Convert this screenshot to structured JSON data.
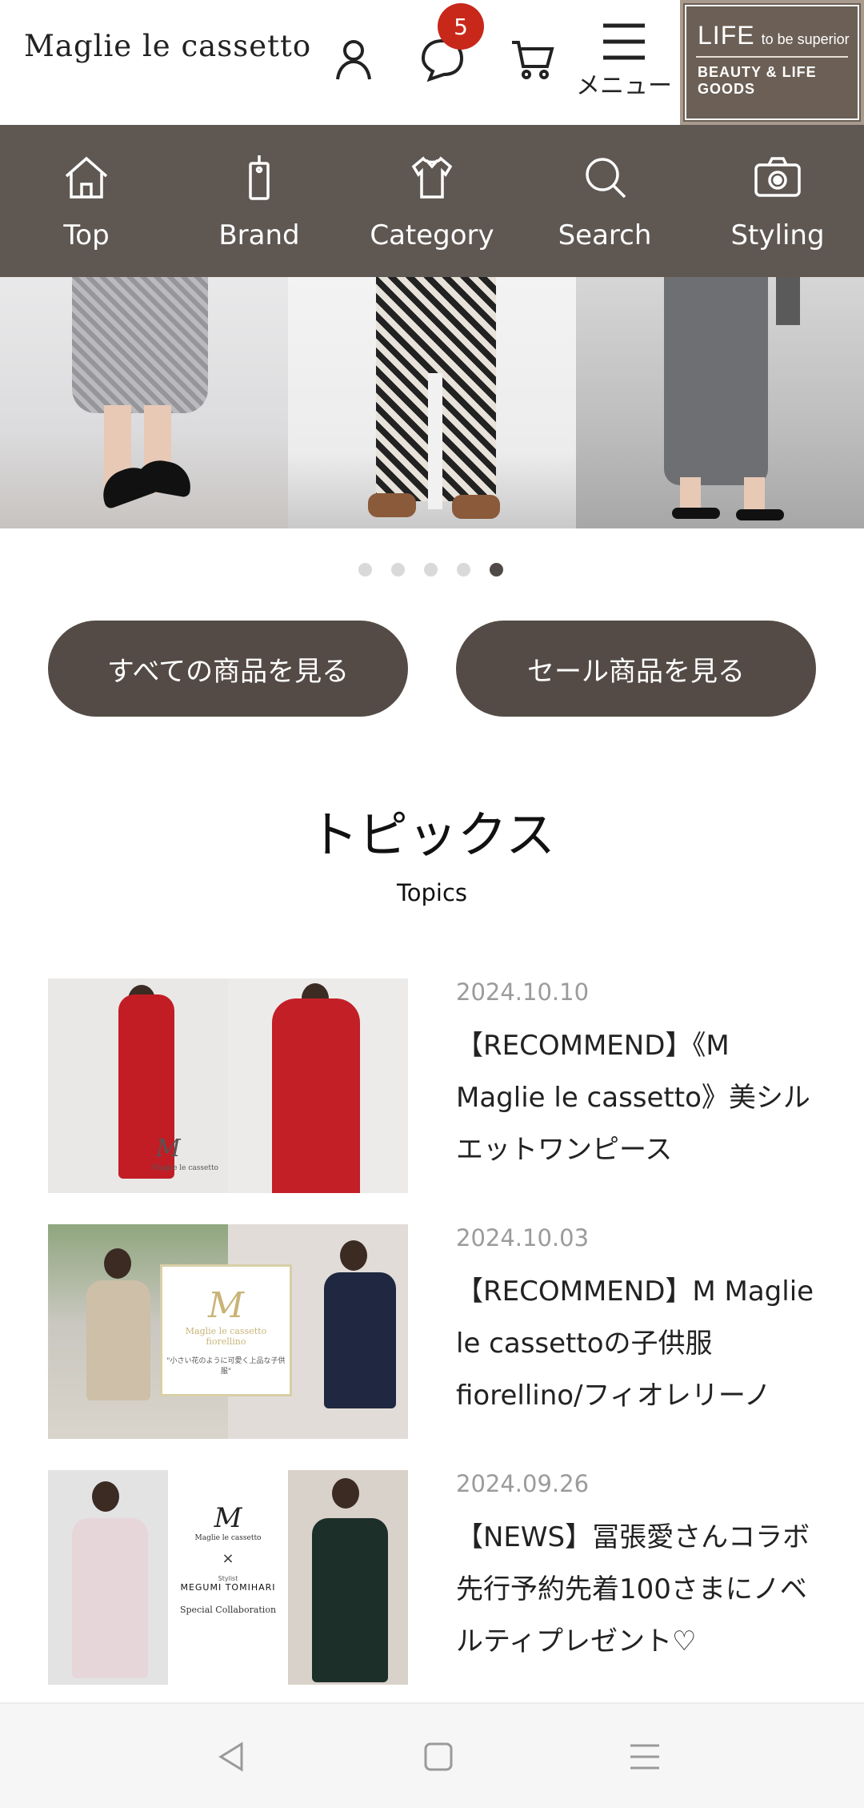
{
  "header": {
    "logo": "Maglie le cassetto",
    "badge_count": "5",
    "menu_label": "メニュー",
    "life_banner": {
      "life": "LIFE",
      "tagline": "to be superior",
      "goods": "BEAUTY & LIFE GOODS"
    }
  },
  "nav": {
    "items": [
      {
        "label": "Top",
        "icon": "home-icon"
      },
      {
        "label": "Brand",
        "icon": "tag-icon"
      },
      {
        "label": "Category",
        "icon": "shirt-icon"
      },
      {
        "label": "Search",
        "icon": "search-icon"
      },
      {
        "label": "Styling",
        "icon": "camera-icon"
      }
    ]
  },
  "carousel": {
    "total": 5,
    "active_index": 4
  },
  "buttons": {
    "all_items": "すべての商品を見る",
    "sale_items": "セール商品を見る"
  },
  "topics": {
    "title": "トピックス",
    "subtitle": "Topics",
    "items": [
      {
        "date": "2024.10.10",
        "title": "【RECOMMEND】《M Maglie le cassetto》美シルエットワンピース",
        "thumb_logo": "Maglie le cassetto"
      },
      {
        "date": "2024.10.03",
        "title": "【RECOMMEND】M Maglie le cassettoの子供服 fiorellino/フィオレリーノ",
        "thumb_logo": "Maglie le cassetto",
        "thumb_sub": "fiorellino",
        "thumb_copy": "\"小さい花のように可愛く上品な子供服\""
      },
      {
        "date": "2024.09.26",
        "title": "【NEWS】冨張愛さんコラボ 先行予約先着100さまにノベルティプレゼント♡",
        "thumb_logo": "Maglie le cassetto",
        "thumb_stylist": "Stylist",
        "thumb_name": "MEGUMI TOMIHARI",
        "thumb_collab": "Special Collaboration"
      }
    ]
  },
  "colors": {
    "nav_bg": "#5f5752",
    "button_bg": "#544b46",
    "badge": "#c8281a",
    "date_text": "#9b9b9b"
  }
}
